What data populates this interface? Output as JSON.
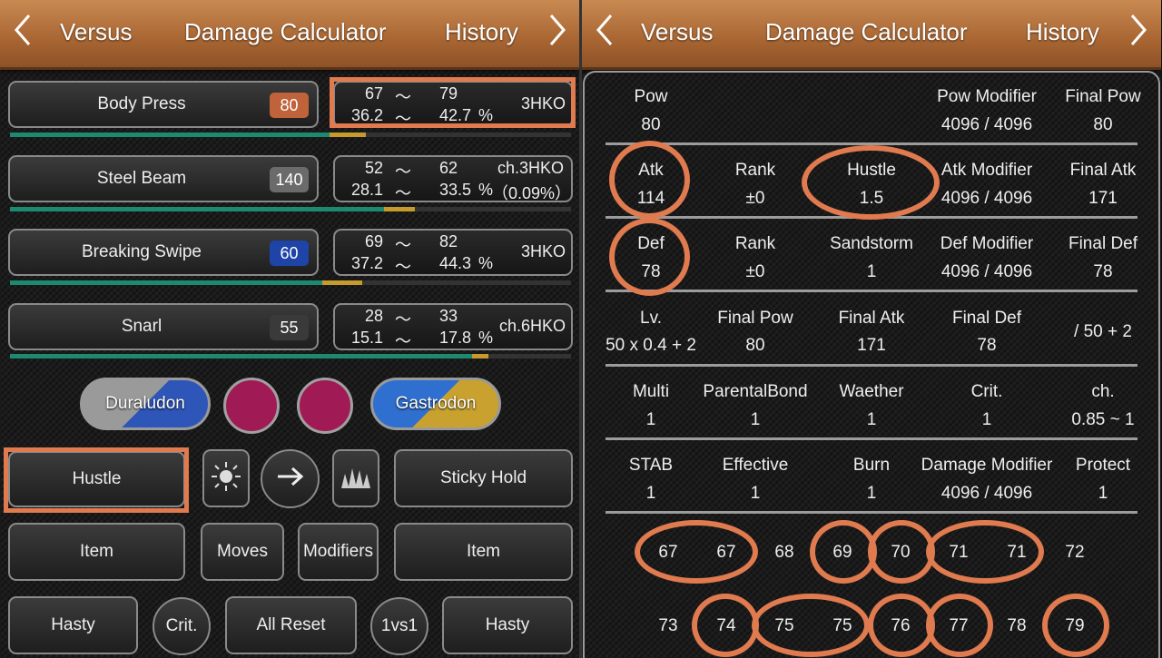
{
  "left": {
    "topbar": {
      "left_label": "Versus",
      "title": "Damage Calculator",
      "right_label": "History"
    },
    "moves": [
      {
        "name": "Body Press",
        "power": "80",
        "power_color": "#c0623a",
        "min": "67",
        "max": "79",
        "min_pct": "36.2",
        "max_pct": "42.7",
        "tilde": "〜",
        "pct_sign": "%",
        "ko": "3HKO",
        "bar_green": 0.57,
        "bar_yellow": 0.065
      },
      {
        "name": "Steel Beam",
        "power": "140",
        "power_color": "#6b6b6b",
        "min": "52",
        "max": "62",
        "min_pct": "28.1",
        "max_pct": "33.5",
        "tilde": "〜",
        "pct_sign": "%",
        "ko": "ch.3HKO",
        "ko2": "（0.09%）",
        "bar_green": 0.667,
        "bar_yellow": 0.055
      },
      {
        "name": "Breaking Swipe",
        "power": "60",
        "power_color": "#1f44a8",
        "min": "69",
        "max": "82",
        "min_pct": "37.2",
        "max_pct": "44.3",
        "tilde": "〜",
        "pct_sign": "%",
        "ko": "3HKO",
        "bar_green": 0.556,
        "bar_yellow": 0.072
      },
      {
        "name": "Snarl",
        "power": "55",
        "power_color": "#3a3a3a",
        "min": "28",
        "max": "33",
        "min_pct": "15.1",
        "max_pct": "17.8",
        "tilde": "〜",
        "pct_sign": "%",
        "ko": "ch.6HKO",
        "bar_green": 0.824,
        "bar_yellow": 0.028
      }
    ],
    "attacker": "Duraludon",
    "defender": "Gastrodon",
    "ability_attacker": "Hustle",
    "ability_defender": "Sticky Hold",
    "item_left": "Item",
    "moves_btn": "Moves",
    "modifiers_btn": "Modifiers",
    "item_right": "Item",
    "nature_left": "Hasty",
    "crit_btn": "Crit.",
    "reset_btn": "All Reset",
    "mode_btn": "1vs1",
    "nature_right": "Hasty",
    "colors": {
      "accent": "#e07a4f",
      "bar_green": "#1b8a6e",
      "bar_yellow": "#c69a2b",
      "pink": "#a01a55"
    }
  },
  "right": {
    "topbar": {
      "left_label": "Versus",
      "title": "Damage Calculator",
      "right_label": "History"
    },
    "pow": {
      "pow_label": "Pow",
      "pow": "80",
      "mod_label": "Pow Modifier",
      "mod": "4096 / 4096",
      "final_label": "Final Pow",
      "final": "80"
    },
    "atk": {
      "atk_label": "Atk",
      "atk": "114",
      "rank_label": "Rank",
      "rank": "±0",
      "ab_label": "Hustle",
      "ab": "1.5",
      "mod_label": "Atk Modifier",
      "mod": "4096 / 4096",
      "final_label": "Final Atk",
      "final": "171"
    },
    "def": {
      "def_label": "Def",
      "def": "78",
      "rank_label": "Rank",
      "rank": "±0",
      "w_label": "Sandstorm",
      "w": "1",
      "mod_label": "Def Modifier",
      "mod": "4096 / 4096",
      "final_label": "Final Def",
      "final": "78"
    },
    "formula": {
      "lv_label": "Lv.",
      "lv": "50 x 0.4 + 2",
      "pow_label": "Final Pow",
      "pow": "80",
      "atk_label": "Final Atk",
      "atk": "171",
      "def_label": "Final Def",
      "def": "78",
      "tail": "/ 50 + 2"
    },
    "mult1": {
      "multi_label": "Multi",
      "multi": "1",
      "pb_label": "ParentalBond",
      "pb": "1",
      "weather_label": "Waether",
      "weather": "1",
      "crit_label": "Crit.",
      "crit": "1",
      "ch_label": "ch.",
      "ch": "0.85 ~ 1"
    },
    "mult2": {
      "stab_label": "STAB",
      "stab": "1",
      "eff_label": "Effective",
      "eff": "1",
      "burn_label": "Burn",
      "burn": "1",
      "dm_label": "Damage Modifier",
      "dm": "4096 / 4096",
      "protect_label": "Protect",
      "protect": "1"
    },
    "rolls_row1": [
      "67",
      "67",
      "68",
      "69",
      "70",
      "71",
      "71",
      "72"
    ],
    "rolls_row2": [
      "73",
      "74",
      "75",
      "75",
      "76",
      "77",
      "78",
      "79"
    ]
  }
}
